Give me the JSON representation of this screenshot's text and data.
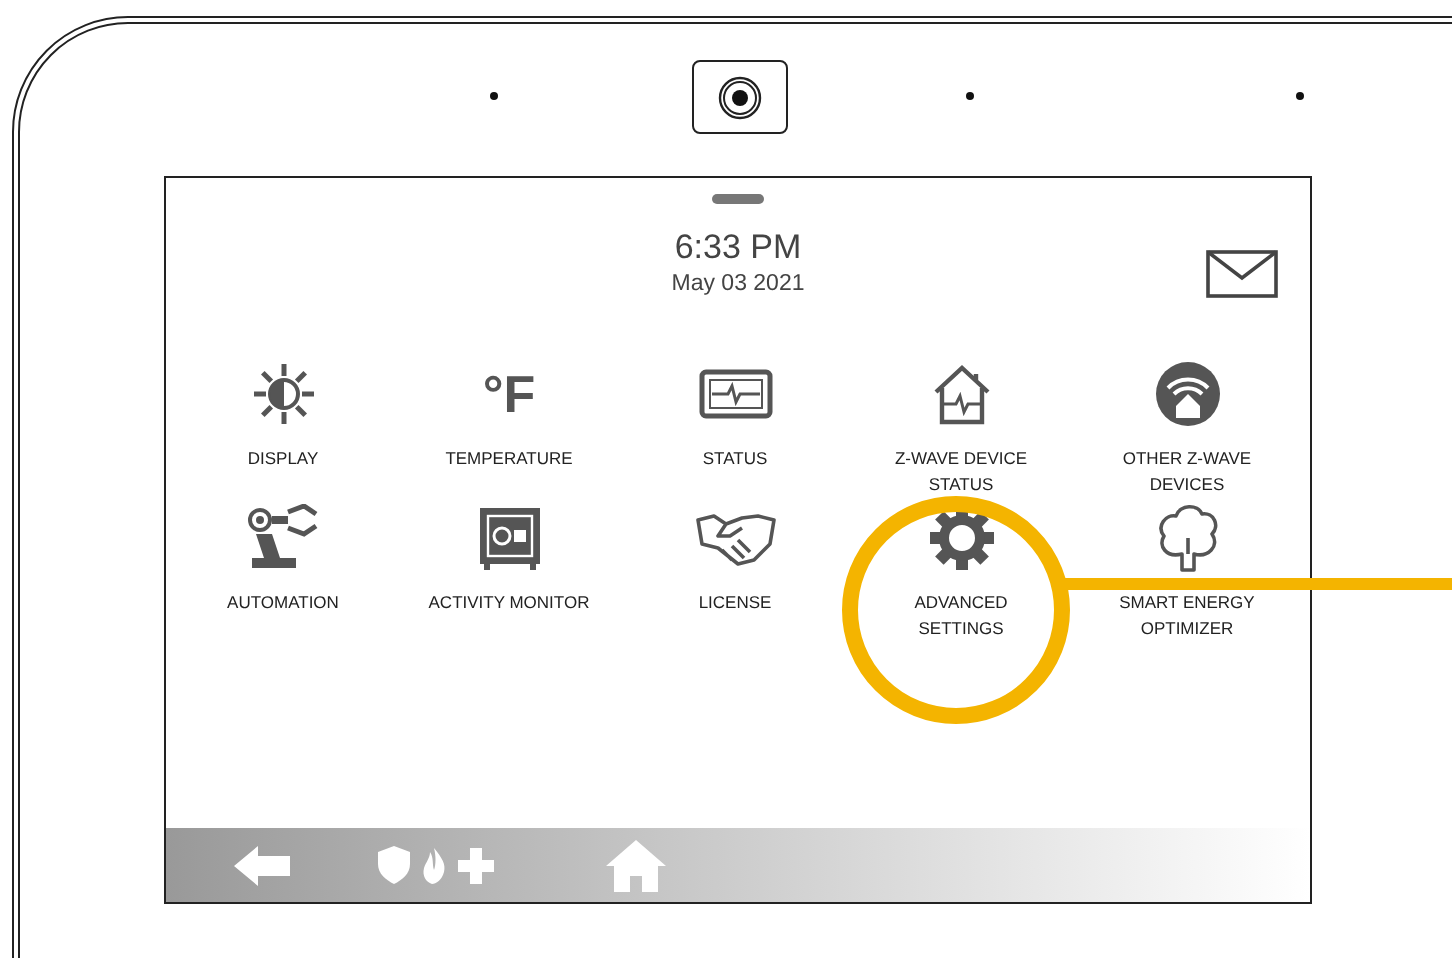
{
  "screen": {
    "time": "6:33 PM",
    "date": "May 03 2021",
    "tiles": [
      {
        "label": "DISPLAY"
      },
      {
        "label": "TEMPERATURE",
        "symbol": "°F"
      },
      {
        "label": "STATUS"
      },
      {
        "label": "Z-WAVE DEVICE\nSTATUS"
      },
      {
        "label": "OTHER Z-WAVE\nDEVICES"
      },
      {
        "label": "AUTOMATION"
      },
      {
        "label": "ACTIVITY MONITOR"
      },
      {
        "label": "LICENSE"
      },
      {
        "label": "ADVANCED\nSETTINGS"
      },
      {
        "label": "SMART ENERGY\nOPTIMIZER"
      }
    ]
  }
}
